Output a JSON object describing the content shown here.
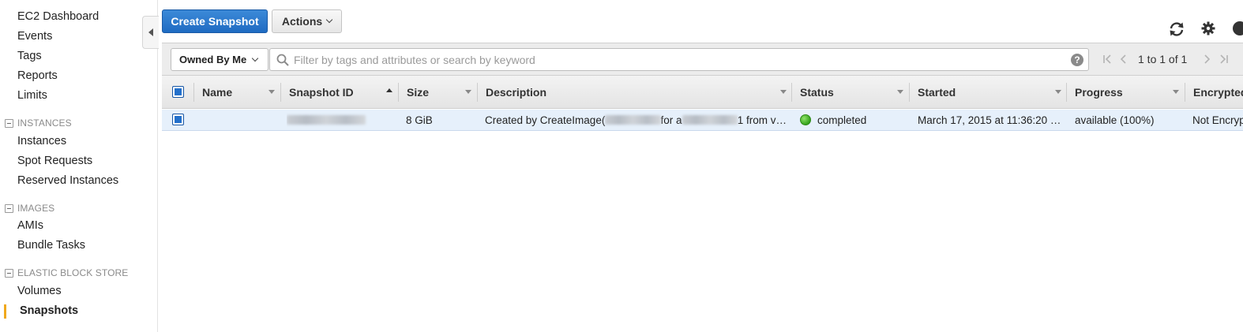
{
  "sidebar": {
    "top_items": [
      {
        "label": "EC2 Dashboard"
      },
      {
        "label": "Events"
      },
      {
        "label": "Tags"
      },
      {
        "label": "Reports"
      },
      {
        "label": "Limits"
      }
    ],
    "sections": [
      {
        "title": "INSTANCES",
        "items": [
          {
            "label": "Instances"
          },
          {
            "label": "Spot Requests"
          },
          {
            "label": "Reserved Instances"
          }
        ]
      },
      {
        "title": "IMAGES",
        "items": [
          {
            "label": "AMIs"
          },
          {
            "label": "Bundle Tasks"
          }
        ]
      },
      {
        "title": "ELASTIC BLOCK STORE",
        "items": [
          {
            "label": "Volumes"
          },
          {
            "label": "Snapshots"
          }
        ]
      }
    ],
    "active_item": "Snapshots"
  },
  "toolbar": {
    "create_label": "Create Snapshot",
    "actions_label": "Actions"
  },
  "filter": {
    "owner_label": "Owned By Me",
    "search_placeholder": "Filter by tags and attributes or search by keyword",
    "pagination": "1 to 1 of 1"
  },
  "table": {
    "columns": [
      "Name",
      "Snapshot ID",
      "Size",
      "Description",
      "Status",
      "Started",
      "Progress",
      "Encrypted"
    ],
    "sorted_column": "Snapshot ID",
    "rows": [
      {
        "name": "",
        "snapshot_id": "",
        "size": "8 GiB",
        "description_prefix": "Created by CreateImage(",
        "description_mid": "for a",
        "description_suffix": "1 from v…",
        "status": "completed",
        "started": "March 17, 2015 at 11:36:20 …",
        "progress": "available (100%)",
        "encrypted": "Not Encrypted"
      }
    ]
  },
  "colors": {
    "primary_button": "#1f6bc2",
    "active_accent": "#f0a81c",
    "status_completed": "#36a31c",
    "selected_row": "#e6f0fb"
  },
  "icons": [
    "sidebar-collapse-icon",
    "refresh-icon",
    "gear-icon",
    "help-icon",
    "search-icon",
    "first-page-icon",
    "prev-page-icon",
    "next-page-icon",
    "last-page-icon"
  ]
}
